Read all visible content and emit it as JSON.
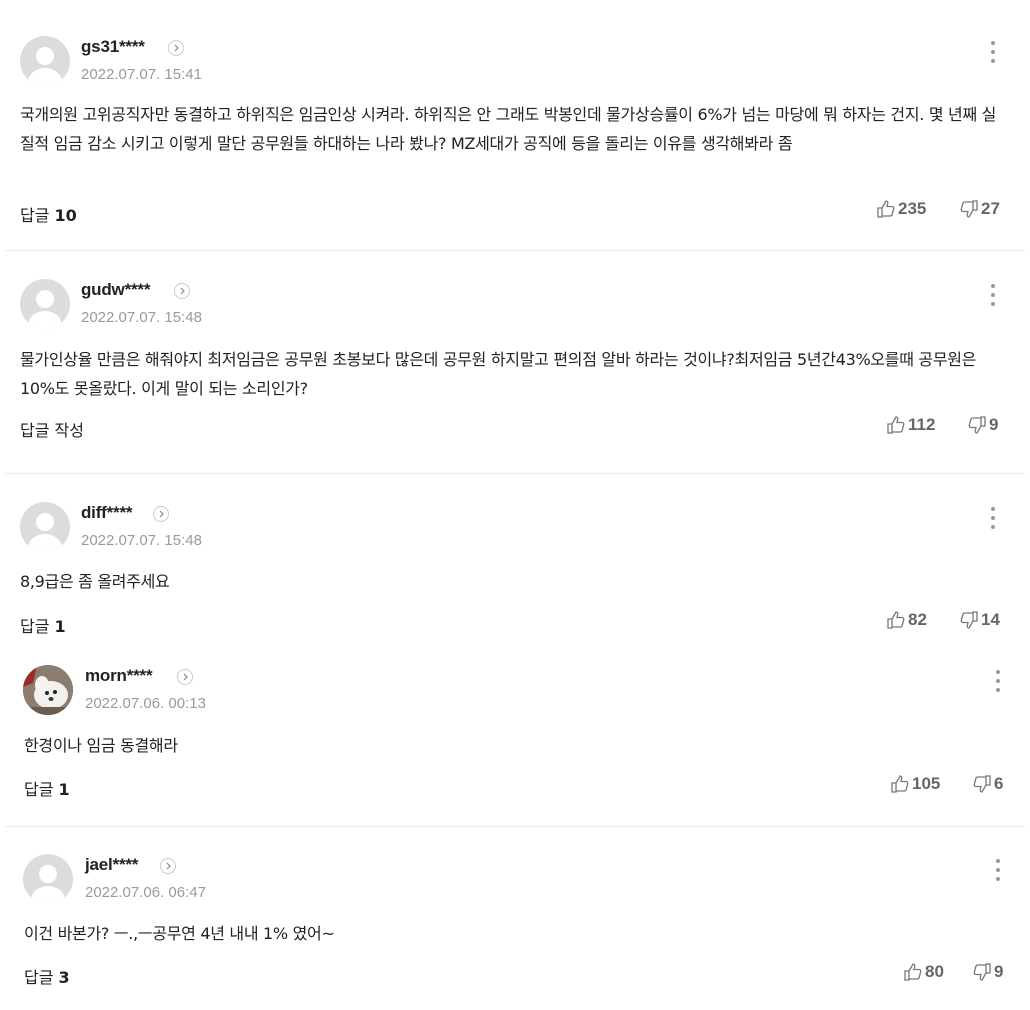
{
  "labels": {
    "reply": "답글",
    "reply_write": "작성"
  },
  "comments": [
    {
      "nick": "gs31****",
      "date": "2022.07.07. 15:41",
      "text": "국개의원 고위공직자만 동결하고 하위직은 임금인상 시켜라. 하위직은 안 그래도 박봉인데 물가상승률이 6%가 넘는 마당에 뭐 하자는 건지. 몇 년째 실질적 임금 감소 시키고 이렇게 말단 공무원들 하대하는 나라 봤나? MZ세대가 공직에 등을 돌리는 이유를 생각해봐라 좀",
      "reply_count": "10",
      "likes": "235",
      "dislikes": "27"
    },
    {
      "nick": "gudw****",
      "date": "2022.07.07. 15:48",
      "text": "물가인상율 만큼은 해줘야지 최저임금은 공무원 초봉보다 많은데 공무원 하지말고 편의점 알바 하라는 것이냐?최저임금 5년간43%오를때 공무원은 10%도 못올랐다. 이게 말이 되는 소리인가?",
      "reply_count": "",
      "likes": "112",
      "dislikes": "9"
    },
    {
      "nick": "diff****",
      "date": "2022.07.07. 15:48",
      "text": "8,9급은 좀 올려주세요",
      "reply_count": "1",
      "likes": "82",
      "dislikes": "14"
    },
    {
      "nick": "morn****",
      "date": "2022.07.06. 00:13",
      "text": "한경이나 임금 동결해라",
      "reply_count": "1",
      "likes": "105",
      "dislikes": "6"
    },
    {
      "nick": "jael****",
      "date": "2022.07.06. 06:47",
      "text": "이건 바본가? ㅡ.,ㅡ공무연 4년 내내 1% 였어~",
      "reply_count": "3",
      "likes": "80",
      "dislikes": "9"
    }
  ]
}
